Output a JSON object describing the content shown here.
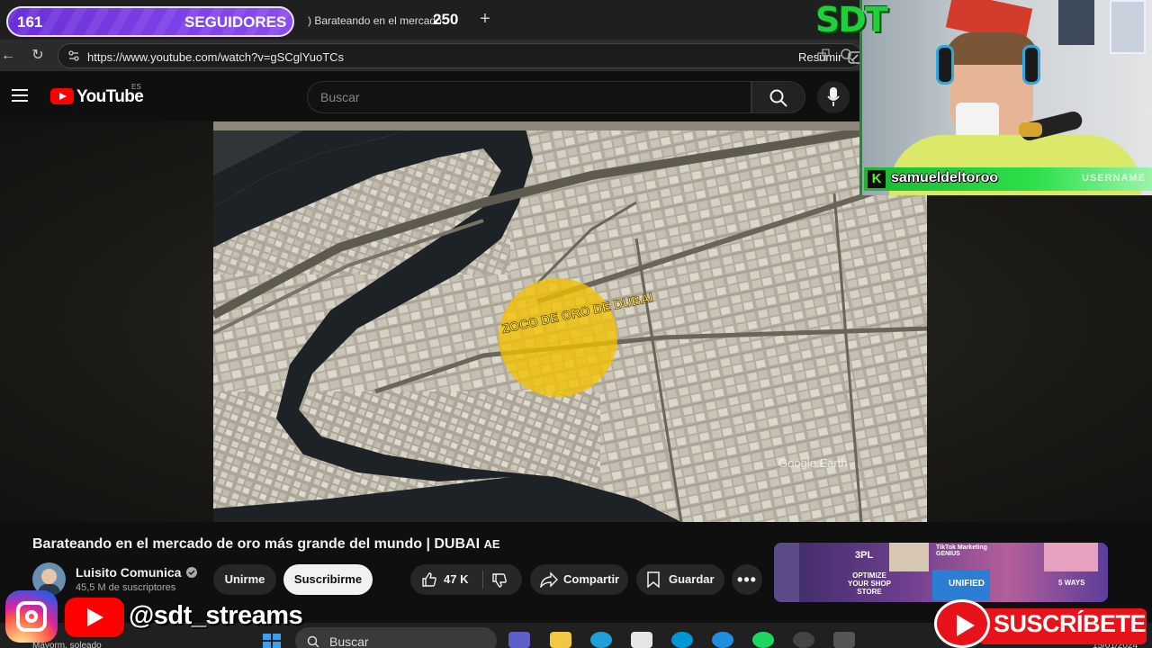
{
  "browser": {
    "tab_title": ") Barateando en el mercado",
    "url": "https://www.youtube.com/watch?v=gSCglYuoTCs",
    "resumir": "Resumir",
    "new_tab": "+"
  },
  "youtube": {
    "logo": "YouTube",
    "region": "ES",
    "search_placeholder": "Buscar"
  },
  "video": {
    "map_label": "ZOCO DE ORO DE DUBAI",
    "watermark": "Google Earth",
    "title": "Barateando en el mercado de oro más grande del mundo | DUBAI",
    "title_flag": "AE"
  },
  "channel": {
    "name": "Luisito Comunica",
    "subscribers": "45,5 M de suscriptores",
    "join": "Unirme",
    "subscribe": "Suscribirme"
  },
  "actions": {
    "likes": "47 K",
    "share": "Compartir",
    "save": "Guardar"
  },
  "overlay": {
    "followers": "161",
    "followers_label": "SEGUIDORES",
    "followers_goal": "250",
    "logo": "SDT",
    "username": "samueldeltoroo",
    "username_label": "USERNAME",
    "handle": "@sdt_streams",
    "subscribe": "SUSCRÍBETE"
  },
  "thumbs": {
    "labels": [
      "3PL",
      "TikTok Marketing GENIUS",
      "OPTIMIZE YOUR SHOP STORE",
      "UNIFIED",
      "5 WAYS"
    ]
  },
  "taskbar": {
    "search": "Buscar",
    "weather": "Mayorm. soleado",
    "date": "15/01/2024"
  },
  "colors": {
    "youtube_red": "#ff0000",
    "kick_green": "#53fc18",
    "twitch_purple": "#8a4cf0",
    "gold_marker": "#f2c200"
  }
}
